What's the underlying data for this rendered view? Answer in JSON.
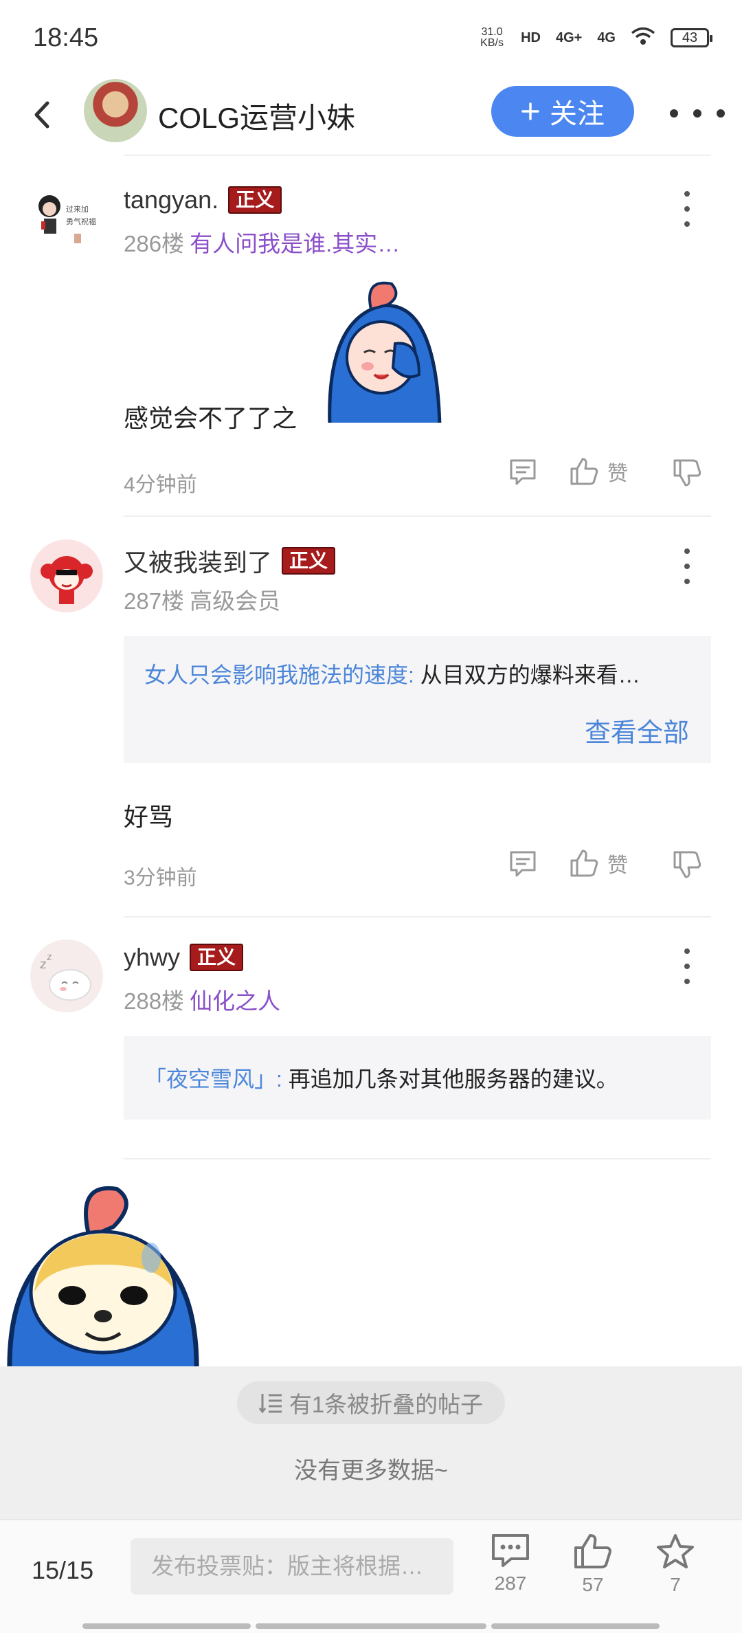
{
  "status_bar": {
    "time": "18:45",
    "net_speed_value": "31.0",
    "net_speed_unit": "KB/s",
    "hd_label": "HD",
    "signal1": "4G+",
    "signal2": "4G",
    "battery": "43"
  },
  "header": {
    "title": "COLG运营小妹",
    "follow_label": "关注"
  },
  "posts": [
    {
      "username": "tangyan.",
      "badge": "正义",
      "floor": "286楼",
      "level": "有人问我是谁.其实…",
      "avatar_caption_1": "过来加",
      "avatar_caption_2": "勇气祝福",
      "content": "感觉会不了了之",
      "time": "4分钟前",
      "like_label": "赞"
    },
    {
      "username": "又被我装到了",
      "badge": "正义",
      "floor": "287楼",
      "level": "高级会员",
      "quote_name": "女人只会影响我施法的速度:",
      "quote_text": " 从目双方的爆料来看…",
      "view_all": "查看全部",
      "content": "好骂",
      "time": "3分钟前",
      "like_label": "赞"
    },
    {
      "username": "yhwy",
      "badge": "正义",
      "floor": "288楼",
      "level": "仙化之人",
      "quote_name": "「夜空雪风」:",
      "quote_text": " 再追加几条对其他服务器的建议。"
    }
  ],
  "folded": {
    "label": "有1条被折叠的帖子",
    "no_more": "没有更多数据~"
  },
  "bottom_bar": {
    "page": "15/15",
    "input_placeholder": "发布投票贴：版主将根据…",
    "comments_count": "287",
    "likes_count": "57",
    "favorites_count": "7"
  },
  "colors": {
    "accent": "#4b86f1",
    "badge": "#a61c1c",
    "link": "#4b86d9",
    "level": "#8a4fc9"
  }
}
